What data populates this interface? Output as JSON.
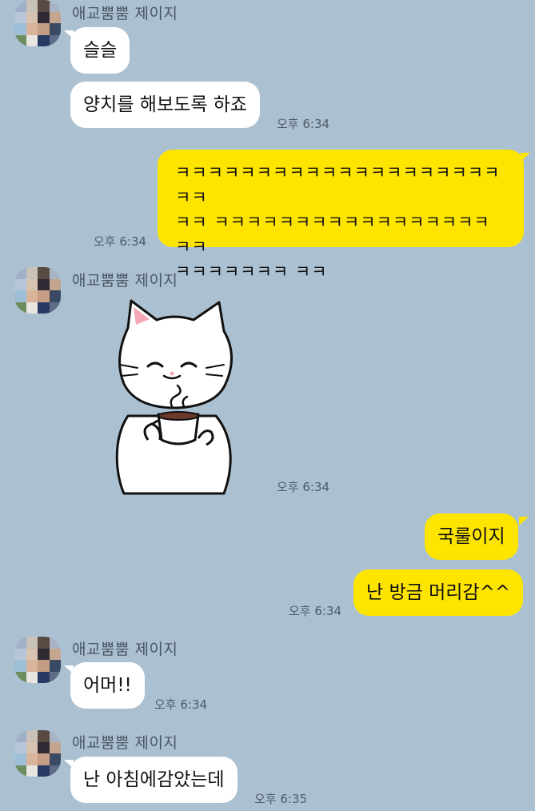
{
  "sender_name": "애교뿜뿜 제이지",
  "messages": {
    "m1": "슬슬",
    "m2": "양치를 해보도록 하죠",
    "t2": "오후 6:34",
    "m3_line1": "ㅋㅋㅋㅋㅋㅋㅋㅋㅋㅋㅋㅋㅋㅋㅋㅋㅋㅋㅋㅋㅋㅋ",
    "m3_line2": "ㅋㅋ ㅋㅋㅋㅋㅋㅋㅋㅋㅋㅋㅋㅋㅋㅋㅋㅋㅋㅋㅋ",
    "m3_line3": "ㅋㅋㅋㅋㅋㅋㅋ ㅋㅋ",
    "t3": "오후 6:34",
    "t_sticker": "오후 6:34",
    "m5": "국룰이지",
    "m6": "난 방금 머리감^^",
    "t6": "오후 6:34",
    "m7": "어머!!",
    "t7": "오후 6:34",
    "m8": "난 아침에감았는데",
    "t8": "오후 6:35"
  },
  "colors": {
    "background": "#abc1d1",
    "incoming_bubble": "#ffffff",
    "outgoing_bubble": "#fee500"
  },
  "icons": {
    "sticker": "cat-drinking-coffee-sticker",
    "avatar": "pixelated-profile-avatar"
  }
}
